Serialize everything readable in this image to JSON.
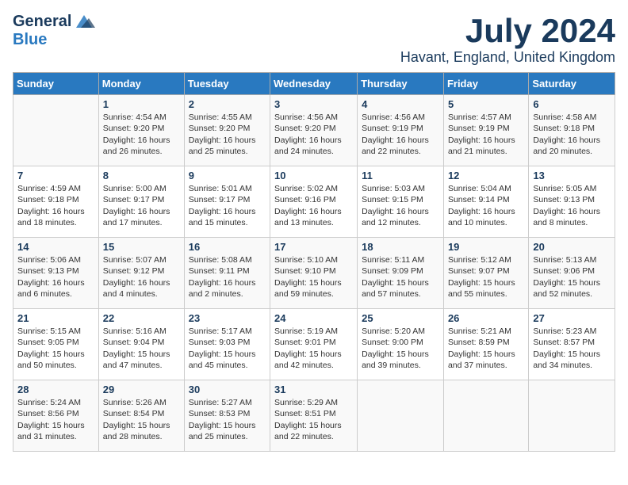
{
  "header": {
    "logo_general": "General",
    "logo_blue": "Blue",
    "month_title": "July 2024",
    "location": "Havant, England, United Kingdom"
  },
  "weekdays": [
    "Sunday",
    "Monday",
    "Tuesday",
    "Wednesday",
    "Thursday",
    "Friday",
    "Saturday"
  ],
  "weeks": [
    [
      {
        "day": "",
        "content": ""
      },
      {
        "day": "1",
        "content": "Sunrise: 4:54 AM\nSunset: 9:20 PM\nDaylight: 16 hours\nand 26 minutes."
      },
      {
        "day": "2",
        "content": "Sunrise: 4:55 AM\nSunset: 9:20 PM\nDaylight: 16 hours\nand 25 minutes."
      },
      {
        "day": "3",
        "content": "Sunrise: 4:56 AM\nSunset: 9:20 PM\nDaylight: 16 hours\nand 24 minutes."
      },
      {
        "day": "4",
        "content": "Sunrise: 4:56 AM\nSunset: 9:19 PM\nDaylight: 16 hours\nand 22 minutes."
      },
      {
        "day": "5",
        "content": "Sunrise: 4:57 AM\nSunset: 9:19 PM\nDaylight: 16 hours\nand 21 minutes."
      },
      {
        "day": "6",
        "content": "Sunrise: 4:58 AM\nSunset: 9:18 PM\nDaylight: 16 hours\nand 20 minutes."
      }
    ],
    [
      {
        "day": "7",
        "content": "Sunrise: 4:59 AM\nSunset: 9:18 PM\nDaylight: 16 hours\nand 18 minutes."
      },
      {
        "day": "8",
        "content": "Sunrise: 5:00 AM\nSunset: 9:17 PM\nDaylight: 16 hours\nand 17 minutes."
      },
      {
        "day": "9",
        "content": "Sunrise: 5:01 AM\nSunset: 9:17 PM\nDaylight: 16 hours\nand 15 minutes."
      },
      {
        "day": "10",
        "content": "Sunrise: 5:02 AM\nSunset: 9:16 PM\nDaylight: 16 hours\nand 13 minutes."
      },
      {
        "day": "11",
        "content": "Sunrise: 5:03 AM\nSunset: 9:15 PM\nDaylight: 16 hours\nand 12 minutes."
      },
      {
        "day": "12",
        "content": "Sunrise: 5:04 AM\nSunset: 9:14 PM\nDaylight: 16 hours\nand 10 minutes."
      },
      {
        "day": "13",
        "content": "Sunrise: 5:05 AM\nSunset: 9:13 PM\nDaylight: 16 hours\nand 8 minutes."
      }
    ],
    [
      {
        "day": "14",
        "content": "Sunrise: 5:06 AM\nSunset: 9:13 PM\nDaylight: 16 hours\nand 6 minutes."
      },
      {
        "day": "15",
        "content": "Sunrise: 5:07 AM\nSunset: 9:12 PM\nDaylight: 16 hours\nand 4 minutes."
      },
      {
        "day": "16",
        "content": "Sunrise: 5:08 AM\nSunset: 9:11 PM\nDaylight: 16 hours\nand 2 minutes."
      },
      {
        "day": "17",
        "content": "Sunrise: 5:10 AM\nSunset: 9:10 PM\nDaylight: 15 hours\nand 59 minutes."
      },
      {
        "day": "18",
        "content": "Sunrise: 5:11 AM\nSunset: 9:09 PM\nDaylight: 15 hours\nand 57 minutes."
      },
      {
        "day": "19",
        "content": "Sunrise: 5:12 AM\nSunset: 9:07 PM\nDaylight: 15 hours\nand 55 minutes."
      },
      {
        "day": "20",
        "content": "Sunrise: 5:13 AM\nSunset: 9:06 PM\nDaylight: 15 hours\nand 52 minutes."
      }
    ],
    [
      {
        "day": "21",
        "content": "Sunrise: 5:15 AM\nSunset: 9:05 PM\nDaylight: 15 hours\nand 50 minutes."
      },
      {
        "day": "22",
        "content": "Sunrise: 5:16 AM\nSunset: 9:04 PM\nDaylight: 15 hours\nand 47 minutes."
      },
      {
        "day": "23",
        "content": "Sunrise: 5:17 AM\nSunset: 9:03 PM\nDaylight: 15 hours\nand 45 minutes."
      },
      {
        "day": "24",
        "content": "Sunrise: 5:19 AM\nSunset: 9:01 PM\nDaylight: 15 hours\nand 42 minutes."
      },
      {
        "day": "25",
        "content": "Sunrise: 5:20 AM\nSunset: 9:00 PM\nDaylight: 15 hours\nand 39 minutes."
      },
      {
        "day": "26",
        "content": "Sunrise: 5:21 AM\nSunset: 8:59 PM\nDaylight: 15 hours\nand 37 minutes."
      },
      {
        "day": "27",
        "content": "Sunrise: 5:23 AM\nSunset: 8:57 PM\nDaylight: 15 hours\nand 34 minutes."
      }
    ],
    [
      {
        "day": "28",
        "content": "Sunrise: 5:24 AM\nSunset: 8:56 PM\nDaylight: 15 hours\nand 31 minutes."
      },
      {
        "day": "29",
        "content": "Sunrise: 5:26 AM\nSunset: 8:54 PM\nDaylight: 15 hours\nand 28 minutes."
      },
      {
        "day": "30",
        "content": "Sunrise: 5:27 AM\nSunset: 8:53 PM\nDaylight: 15 hours\nand 25 minutes."
      },
      {
        "day": "31",
        "content": "Sunrise: 5:29 AM\nSunset: 8:51 PM\nDaylight: 15 hours\nand 22 minutes."
      },
      {
        "day": "",
        "content": ""
      },
      {
        "day": "",
        "content": ""
      },
      {
        "day": "",
        "content": ""
      }
    ]
  ]
}
